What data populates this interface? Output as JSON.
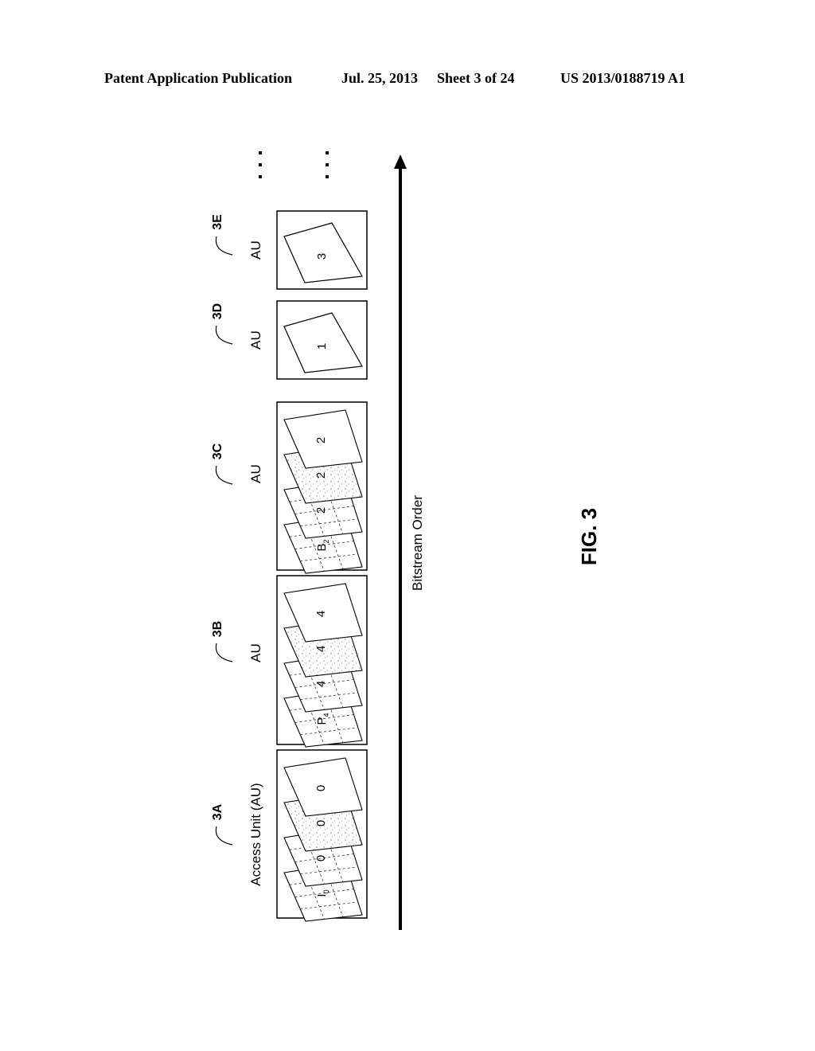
{
  "header": {
    "publication": "Patent Application Publication",
    "date": "Jul. 25, 2013",
    "sheet": "Sheet 3 of 24",
    "number": "US 2013/0188719 A1"
  },
  "figure": {
    "caption": "FIG. 3",
    "axis_label": "Bitstream Order",
    "continuation": "...",
    "access_units": [
      {
        "ref": "3A",
        "label": "Access Unit (AU)",
        "layers": [
          "I",
          "0",
          "0",
          "0"
        ],
        "subscript": "0",
        "layer_count": 4
      },
      {
        "ref": "3B",
        "label": "AU",
        "layers": [
          "P",
          "4",
          "4",
          "4"
        ],
        "subscript": "4",
        "layer_count": 4
      },
      {
        "ref": "3C",
        "label": "AU",
        "layers": [
          "B",
          "2",
          "2",
          "2"
        ],
        "subscript": "2",
        "layer_count": 4
      },
      {
        "ref": "3D",
        "label": "AU",
        "layers": [
          "1"
        ],
        "subscript": "",
        "layer_count": 1
      },
      {
        "ref": "3E",
        "label": "AU",
        "layers": [
          "3"
        ],
        "subscript": "",
        "layer_count": 1
      }
    ]
  }
}
